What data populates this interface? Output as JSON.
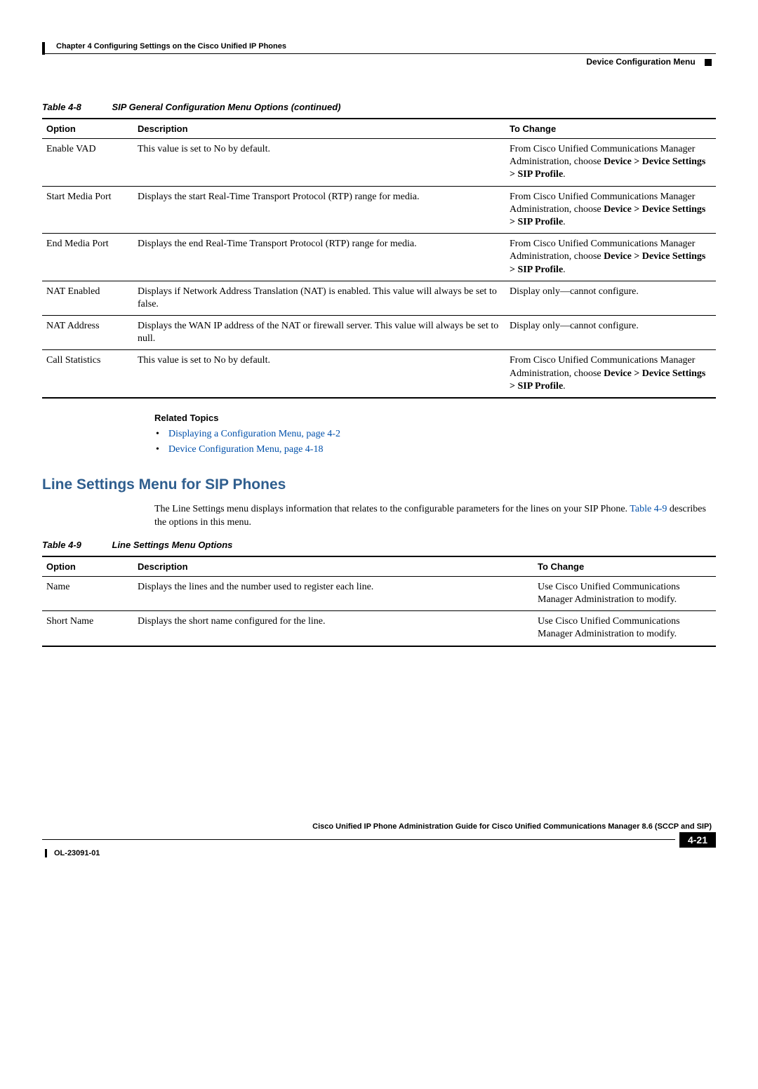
{
  "header": {
    "chapter": "Chapter 4      Configuring Settings on the Cisco Unified IP Phones",
    "section": "Device Configuration Menu"
  },
  "table48": {
    "label": "Table 4-8",
    "title": "SIP General Configuration Menu Options (continued)",
    "cols": {
      "c1": "Option",
      "c2": "Description",
      "c3": "To Change"
    },
    "rows": [
      {
        "option": "Enable VAD",
        "desc": "This value is set to No by default.",
        "change_prefix": "From Cisco Unified Communications Manager Administration, choose ",
        "change_bold": "Device > Device Settings > SIP Profile",
        "change_suffix": "."
      },
      {
        "option": "Start Media Port",
        "desc": "Displays the start Real-Time Transport Protocol (RTP) range for media.",
        "change_prefix": "From Cisco Unified Communications Manager Administration, choose ",
        "change_bold": "Device > Device Settings > SIP Profile",
        "change_suffix": "."
      },
      {
        "option": "End Media Port",
        "desc": "Displays the end Real-Time Transport Protocol (RTP) range for media.",
        "change_prefix": "From Cisco Unified Communications Manager Administration, choose ",
        "change_bold": "Device > Device Settings > SIP Profile",
        "change_suffix": "."
      },
      {
        "option": "NAT Enabled",
        "desc": "Displays if Network Address Translation (NAT) is enabled. This value will always be set to false.",
        "change_plain": "Display only—cannot configure."
      },
      {
        "option": "NAT Address",
        "desc": "Displays the WAN IP address of the NAT or firewall server. This value will always be set to null.",
        "change_plain": "Display only—cannot configure."
      },
      {
        "option": "Call Statistics",
        "desc": "This value is set to No by default.",
        "change_prefix": "From Cisco Unified Communications Manager Administration, choose ",
        "change_bold": "Device > Device Settings > SIP Profile",
        "change_suffix": "."
      }
    ]
  },
  "related": {
    "heading": "Related Topics",
    "items": [
      "Displaying a Configuration Menu, page 4-2",
      "Device Configuration Menu, page 4-18"
    ]
  },
  "section2": {
    "heading": "Line Settings Menu for SIP Phones",
    "para_before": "The Line Settings menu displays information that relates to the configurable parameters for the lines on your SIP Phone. ",
    "para_link": "Table 4-9",
    "para_after": " describes the options in this menu."
  },
  "table49": {
    "label": "Table 4-9",
    "title": "Line Settings Menu Options",
    "cols": {
      "c1": "Option",
      "c2": "Description",
      "c3": "To Change"
    },
    "rows": [
      {
        "option": "Name",
        "desc": "Displays the lines and the number used to register each line.",
        "change": "Use Cisco Unified Communications Manager Administration to modify."
      },
      {
        "option": "Short Name",
        "desc": "Displays the short name configured for the line.",
        "change": "Use Cisco Unified Communications Manager Administration to modify."
      }
    ]
  },
  "footer": {
    "guide": "Cisco Unified IP Phone Administration Guide for Cisco Unified Communications Manager 8.6 (SCCP and SIP)",
    "page": "4-21",
    "docnum": "OL-23091-01"
  }
}
